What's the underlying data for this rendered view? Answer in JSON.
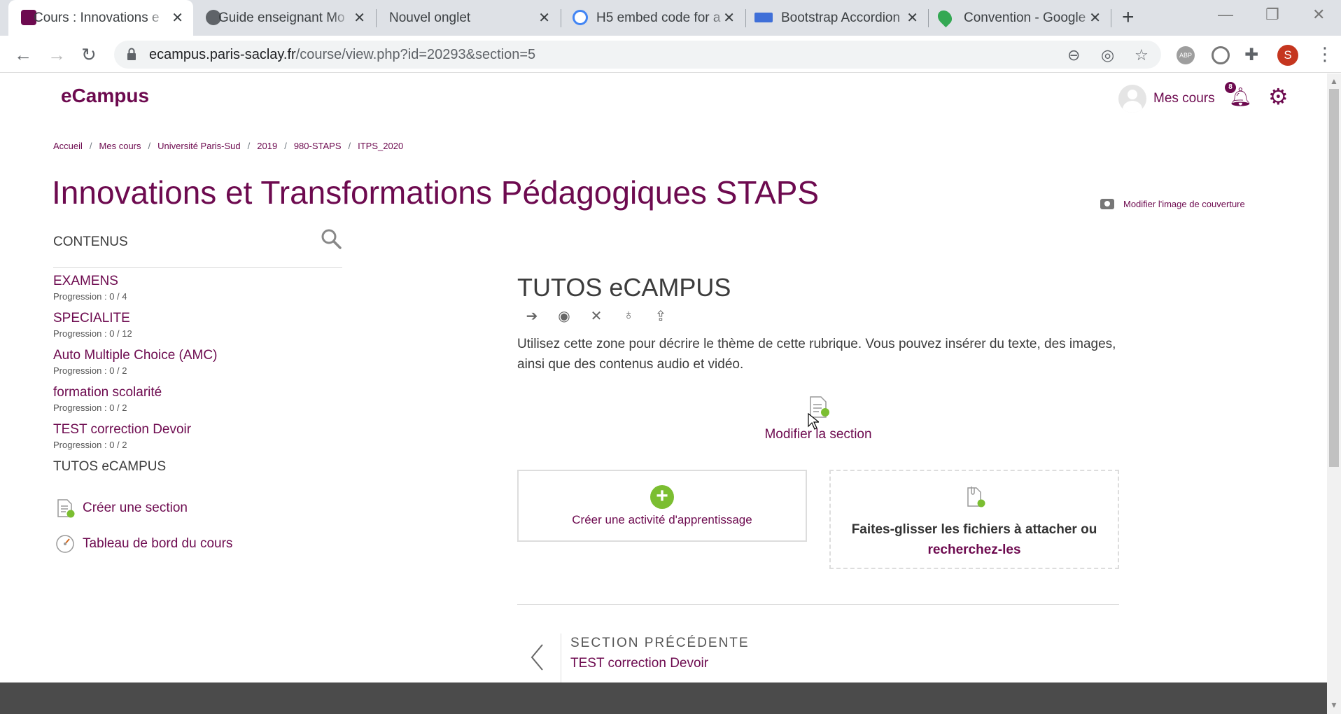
{
  "browser": {
    "tabs": [
      {
        "title": "Cours : Innovations e",
        "active": true
      },
      {
        "title": "Guide enseignant Mo",
        "active": false
      },
      {
        "title": "Nouvel onglet",
        "active": false
      },
      {
        "title": "H5 embed code for a",
        "active": false
      },
      {
        "title": "Bootstrap Accordion",
        "active": false
      },
      {
        "title": "Convention - Google",
        "active": false
      }
    ],
    "url_host": "ecampus.paris-saclay.fr",
    "url_path": "/course/view.php?id=20293&section=5",
    "profile_initial": "S",
    "ext_abp": "ABP"
  },
  "header": {
    "brand": "eCampus",
    "mes_cours": "Mes cours",
    "notification_count": "8"
  },
  "breadcrumb": [
    "Accueil",
    "Mes cours",
    "Université Paris-Sud",
    "2019",
    "980-STAPS",
    "ITPS_2020"
  ],
  "course": {
    "title": "Innovations et Transformations Pédagogiques STAPS",
    "cover_link": "Modifier l'image de couverture"
  },
  "sidebar": {
    "heading": "CONTENUS",
    "sections": [
      {
        "name": "EXAMENS",
        "progress": "Progression : 0 / 4"
      },
      {
        "name": "SPECIALITE",
        "progress": "Progression : 0 / 12"
      },
      {
        "name": "Auto Multiple Choice (AMC)",
        "progress": "Progression : 0 / 2"
      },
      {
        "name": "formation scolarité",
        "progress": "Progression : 0 / 2"
      },
      {
        "name": "TEST correction Devoir",
        "progress": "Progression : 0 / 2"
      },
      {
        "name": "TUTOS eCAMPUS",
        "progress": ""
      }
    ],
    "create_section": "Créer une section",
    "dashboard": "Tableau de bord du cours"
  },
  "main": {
    "section_title": "TUTOS eCAMPUS",
    "description": "Utilisez cette zone pour décrire le thème de cette rubrique. Vous pouvez insérer du texte, des images, ainsi que des contenus audio et vidéo.",
    "edit_section": "Modifier la section",
    "create_activity": "Créer une activité d'apprentissage",
    "drop_text": "Faites-glisser les fichiers à attacher ou",
    "drop_link": "recherchez-les",
    "prev_kicker": "SECTION PRÉCÉDENTE",
    "prev_target": "TEST correction Devoir"
  },
  "colors": {
    "brand": "#6d0a4f",
    "accent_green": "#7bbe31",
    "footer": "#4b4b4b"
  }
}
